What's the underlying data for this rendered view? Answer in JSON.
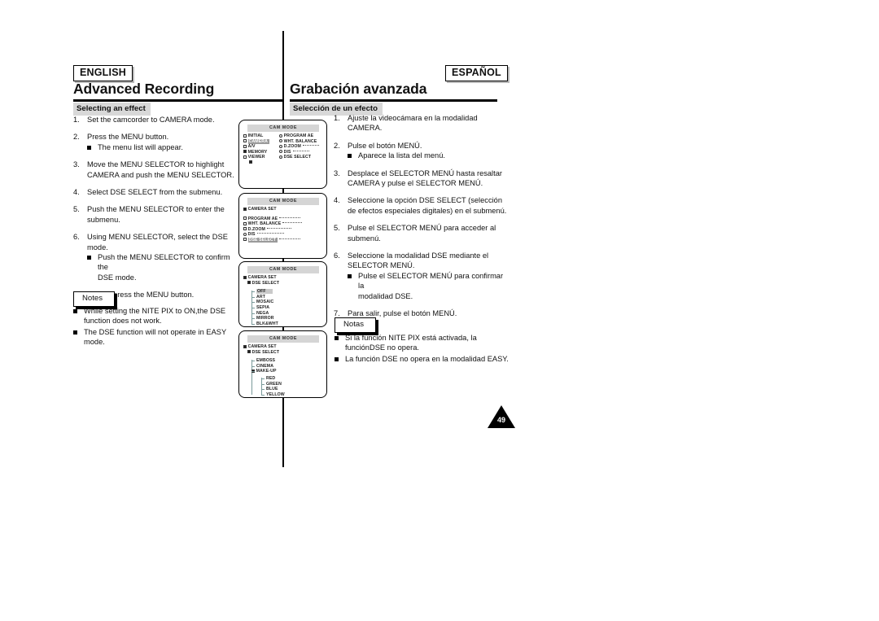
{
  "page": {
    "number": "49",
    "language_left": "ENGLISH",
    "language_right": "ESPAÑOL"
  },
  "left": {
    "chapter_title": "Advanced Recording",
    "section_heading": "Selecting an effect",
    "steps": [
      {
        "num": "1.",
        "lines": [
          "Set the camcorder to CAMERA mode."
        ],
        "bullets": []
      },
      {
        "num": "2.",
        "lines": [
          "Press the MENU button."
        ],
        "bullets": [
          "The menu list will appear."
        ]
      },
      {
        "num": "3.",
        "lines": [
          "Move the MENU SELECTOR to highlight",
          "CAMERA and push the MENU SELECTOR."
        ],
        "bullets": []
      },
      {
        "num": "4.",
        "lines": [
          "Select DSE SELECT from the submenu."
        ],
        "bullets": []
      },
      {
        "num": "5.",
        "lines": [
          "Push the MENU SELECTOR to enter the",
          "submenu."
        ],
        "bullets": []
      },
      {
        "num": "6.",
        "lines": [
          "Using MENU SELECTOR, select the DSE mode."
        ],
        "bullets": [
          "Push the MENU SELECTOR to confirm the",
          "DSE mode."
        ]
      },
      {
        "num": "7.",
        "lines": [
          "To exit, press the MENU button."
        ],
        "bullets": []
      }
    ],
    "notes_label": "Notes",
    "notes": [
      [
        "While setting the NITE PIX to ON,",
        "the DSE function does not work."
      ],
      [
        "The DSE function will not operate in EASY mode."
      ]
    ]
  },
  "right": {
    "chapter_title": "Grabación avanzada",
    "section_heading": "Selección de un efecto",
    "steps": [
      {
        "num": "1.",
        "lines": [
          "Ajuste la videocámara en la modalidad",
          "CAMERA."
        ],
        "bullets": []
      },
      {
        "num": "2.",
        "lines": [
          "Pulse el botón MENÚ."
        ],
        "bullets": [
          "Aparece la lista del menú."
        ]
      },
      {
        "num": "3.",
        "lines": [
          "Desplace el SELECTOR MENÚ hasta resaltar",
          "CAMERA y pulse el SELECTOR MENÚ."
        ],
        "bullets": []
      },
      {
        "num": "4.",
        "lines": [
          "Seleccione la opción DSE SELECT (selección",
          "de efectos especiales digitales) en el submenú."
        ],
        "bullets": []
      },
      {
        "num": "5.",
        "lines": [
          "Pulse el SELECTOR MENÚ para acceder al",
          "submenú."
        ],
        "bullets": []
      },
      {
        "num": "6.",
        "lines": [
          "Seleccione la modalidad DSE mediante el",
          "SELECTOR MENÚ."
        ],
        "bullets": [
          "Pulse el SELECTOR MENÚ para confirmar la",
          "modalidad DSE."
        ]
      },
      {
        "num": "7.",
        "lines": [
          "Para salir, pulse el botón MENÚ."
        ],
        "bullets": []
      }
    ],
    "notes_label": "Notas",
    "notes": [
      [
        "Si la función NITE PIX está activada, la función",
        "DSE no opera."
      ],
      [
        "La función DSE no opera en la modalidad EASY."
      ]
    ]
  },
  "lcd_screens": [
    {
      "header": "CAM MODE",
      "left_column": [
        "INITIAL",
        "CAMERA",
        "A/V",
        "MEMORY",
        "VIEWER"
      ],
      "right_column": [
        "PROGRAM AE",
        "WHT. BALANCE",
        "D.ZOOM",
        "DIS",
        "DSE SELECT"
      ],
      "highlighted_left": "CAMERA",
      "marked_left": "MEMORY"
    },
    {
      "header": "CAM MODE",
      "title": "CAMERA SET",
      "items": [
        "PROGRAM AE",
        "WHT. BALANCE",
        "D.ZOOM",
        "DIS",
        "DSE SELECT"
      ],
      "highlighted": "DSE SELECT"
    },
    {
      "header": "CAM MODE",
      "title": "CAMERA SET",
      "subtitle": "DSE SELECT",
      "items": [
        "OFF",
        "ART",
        "MOSAIC",
        "SEPIA",
        "NEGA",
        "MIRROR",
        "BLK&WHT"
      ],
      "highlighted": "OFF"
    },
    {
      "header": "CAM MODE",
      "title": "CAMERA SET",
      "subtitle": "DSE SELECT",
      "items": [
        "EMBOSS",
        "CINEMA",
        "MAKE-UP"
      ],
      "sub_items": [
        "RED",
        "GREEN",
        "BLUE",
        "YELLOW"
      ],
      "expanded": "MAKE-UP"
    }
  ]
}
